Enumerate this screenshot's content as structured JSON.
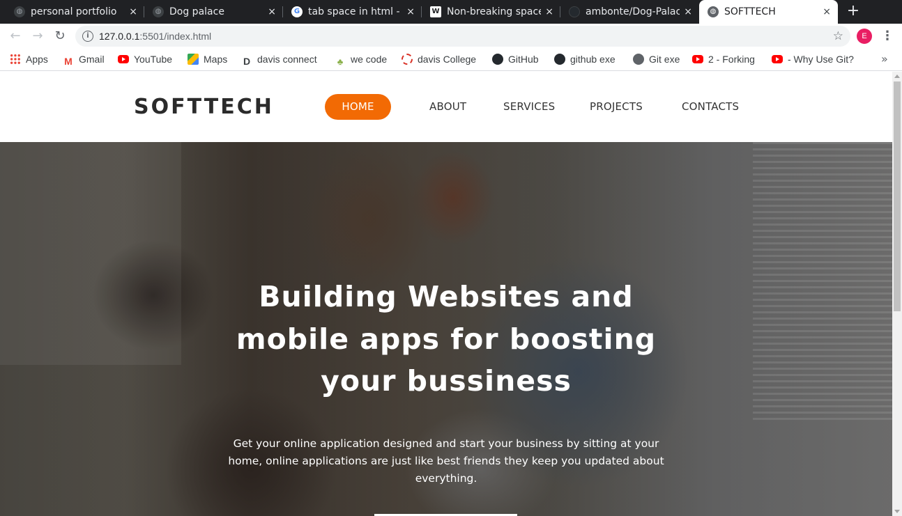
{
  "browser": {
    "tabs": [
      {
        "title": "personal portfolio",
        "icon": "globe-icon",
        "active": false
      },
      {
        "title": "Dog palace",
        "icon": "globe-icon",
        "active": false
      },
      {
        "title": "tab space in html - Google Search",
        "icon": "google-icon",
        "active": false
      },
      {
        "title": "Non-breaking space - Wikipedia",
        "icon": "wikipedia-icon",
        "active": false
      },
      {
        "title": "ambonte/Dog-Palace",
        "icon": "github-icon",
        "active": false
      },
      {
        "title": "SOFTTECH",
        "icon": "globe-icon",
        "active": true
      }
    ],
    "close_glyph": "×",
    "new_tab_glyph": "+",
    "url_host": "127.0.0.1",
    "url_rest": ":5501/index.html",
    "profile_initial": "E",
    "bookmarks": [
      {
        "label": "Apps",
        "icon": "apps-grid-icon"
      },
      {
        "label": "Gmail",
        "icon": "gmail-icon"
      },
      {
        "label": "YouTube",
        "icon": "youtube-icon"
      },
      {
        "label": "Maps",
        "icon": "maps-icon"
      },
      {
        "label": "davis connect",
        "icon": "d-letter-icon"
      },
      {
        "label": "we code",
        "icon": "tree-icon"
      },
      {
        "label": "davis College",
        "icon": "davis-college-icon"
      },
      {
        "label": "GitHub",
        "icon": "github-icon"
      },
      {
        "label": "github exe",
        "icon": "github-icon"
      },
      {
        "label": "Git exe",
        "icon": "globe-icon"
      },
      {
        "label": "2 - Forking",
        "icon": "youtube-icon"
      },
      {
        "label": "- Why Use Git?",
        "icon": "youtube-icon"
      }
    ],
    "bookmarks_more": "»"
  },
  "site": {
    "brand": "SOFTTECH",
    "nav": [
      {
        "label": "HOME",
        "active": true
      },
      {
        "label": "ABOUT",
        "active": false
      },
      {
        "label": "SERVICES",
        "active": false
      },
      {
        "label": "PROJECTS",
        "active": false
      },
      {
        "label": "CONTACTS",
        "active": false
      }
    ],
    "hero": {
      "title_lines": [
        "Building Websites and",
        "mobile apps for boosting",
        "your bussiness"
      ],
      "subtitle": "Get your online application designed and start your business by sitting at your home, online applications are just like best friends they keep you updated about everything."
    },
    "accent_color": "#f26a04"
  }
}
